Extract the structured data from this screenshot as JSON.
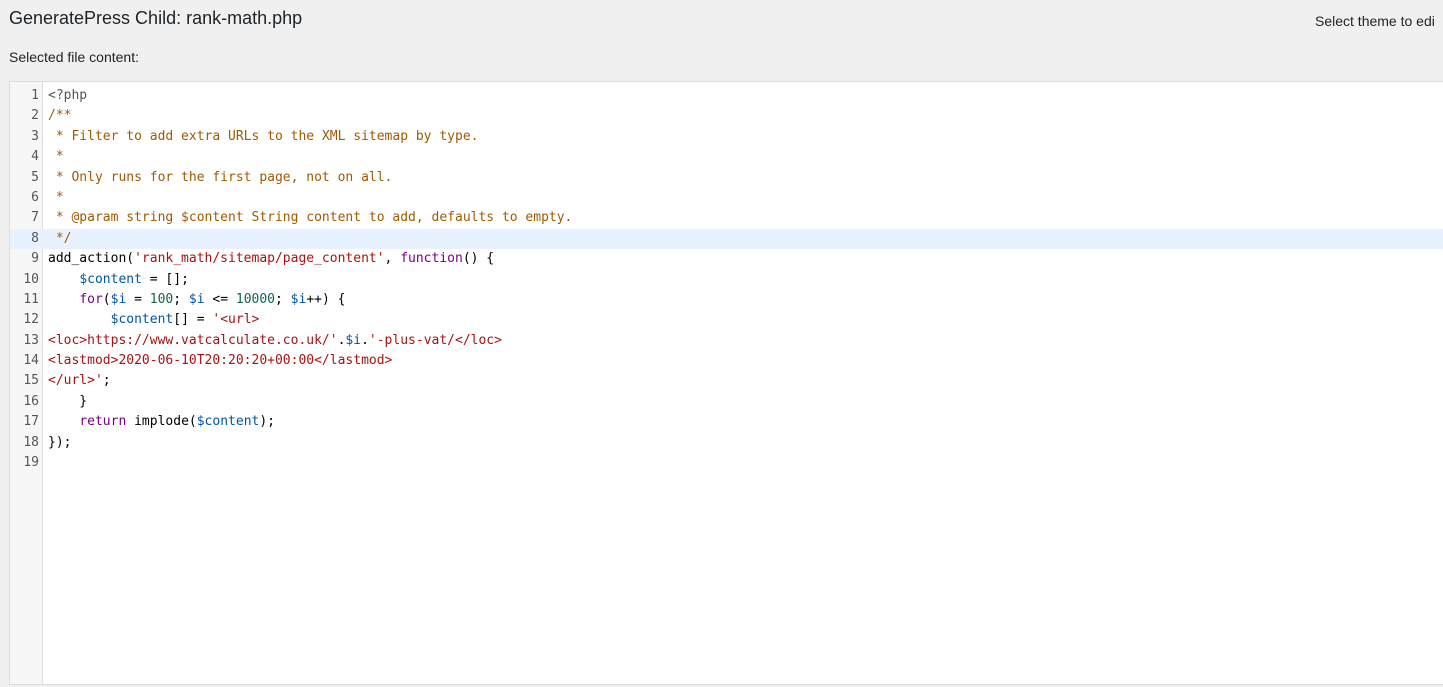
{
  "header": {
    "file_title": "GeneratePress Child: rank-math.php",
    "theme_select_label": "Select theme to edi"
  },
  "editor": {
    "label": "Selected file content:",
    "active_line": 8,
    "lines": [
      {
        "n": "1",
        "tokens": [
          {
            "t": "<?php",
            "c": "meta"
          }
        ]
      },
      {
        "n": "2",
        "tokens": [
          {
            "t": "/**",
            "c": "comment"
          }
        ]
      },
      {
        "n": "3",
        "tokens": [
          {
            "t": " * Filter to add extra URLs to the XML sitemap by type.",
            "c": "comment"
          }
        ]
      },
      {
        "n": "4",
        "tokens": [
          {
            "t": " *",
            "c": "comment"
          }
        ]
      },
      {
        "n": "5",
        "tokens": [
          {
            "t": " * Only runs for the first page, not on all.",
            "c": "comment"
          }
        ]
      },
      {
        "n": "6",
        "tokens": [
          {
            "t": " *",
            "c": "comment"
          }
        ]
      },
      {
        "n": "7",
        "tokens": [
          {
            "t": " * @param string $content String content to add, defaults to empty.",
            "c": "comment"
          }
        ]
      },
      {
        "n": "8",
        "tokens": [
          {
            "t": " */",
            "c": "comment"
          }
        ]
      },
      {
        "n": "9",
        "tokens": [
          {
            "t": "add_action(",
            "c": "plain"
          },
          {
            "t": "'rank_math/sitemap/page_content'",
            "c": "string"
          },
          {
            "t": ", ",
            "c": "plain"
          },
          {
            "t": "function",
            "c": "keyword"
          },
          {
            "t": "() {",
            "c": "plain"
          }
        ]
      },
      {
        "n": "10",
        "tokens": [
          {
            "t": "    ",
            "c": "plain"
          },
          {
            "t": "$content",
            "c": "var"
          },
          {
            "t": " = [];",
            "c": "plain"
          }
        ]
      },
      {
        "n": "11",
        "tokens": [
          {
            "t": "    ",
            "c": "plain"
          },
          {
            "t": "for",
            "c": "keyword"
          },
          {
            "t": "(",
            "c": "plain"
          },
          {
            "t": "$i",
            "c": "var"
          },
          {
            "t": " = ",
            "c": "plain"
          },
          {
            "t": "100",
            "c": "number"
          },
          {
            "t": "; ",
            "c": "plain"
          },
          {
            "t": "$i",
            "c": "var"
          },
          {
            "t": " <= ",
            "c": "plain"
          },
          {
            "t": "10000",
            "c": "number"
          },
          {
            "t": "; ",
            "c": "plain"
          },
          {
            "t": "$i",
            "c": "var"
          },
          {
            "t": "++) {",
            "c": "plain"
          }
        ]
      },
      {
        "n": "12",
        "tokens": [
          {
            "t": "        ",
            "c": "plain"
          },
          {
            "t": "$content",
            "c": "var"
          },
          {
            "t": "[] = ",
            "c": "plain"
          },
          {
            "t": "'<url>",
            "c": "string"
          }
        ]
      },
      {
        "n": "13",
        "tokens": [
          {
            "t": "<loc>https://www.vatcalculate.co.uk/'",
            "c": "string"
          },
          {
            "t": ".",
            "c": "plain"
          },
          {
            "t": "$i",
            "c": "var"
          },
          {
            "t": ".",
            "c": "plain"
          },
          {
            "t": "'-plus-vat/</loc>",
            "c": "string"
          }
        ]
      },
      {
        "n": "14",
        "tokens": [
          {
            "t": "<lastmod>2020-06-10T20:20:20+00:00</lastmod>",
            "c": "string"
          }
        ]
      },
      {
        "n": "15",
        "tokens": [
          {
            "t": "</url>'",
            "c": "string"
          },
          {
            "t": ";",
            "c": "plain"
          }
        ]
      },
      {
        "n": "16",
        "tokens": [
          {
            "t": "    }",
            "c": "plain"
          }
        ]
      },
      {
        "n": "17",
        "tokens": [
          {
            "t": "    ",
            "c": "plain"
          },
          {
            "t": "return",
            "c": "keyword"
          },
          {
            "t": " implode(",
            "c": "plain"
          },
          {
            "t": "$content",
            "c": "var"
          },
          {
            "t": ");",
            "c": "plain"
          }
        ]
      },
      {
        "n": "18",
        "tokens": [
          {
            "t": "});",
            "c": "plain"
          }
        ]
      },
      {
        "n": "19",
        "tokens": []
      }
    ]
  }
}
